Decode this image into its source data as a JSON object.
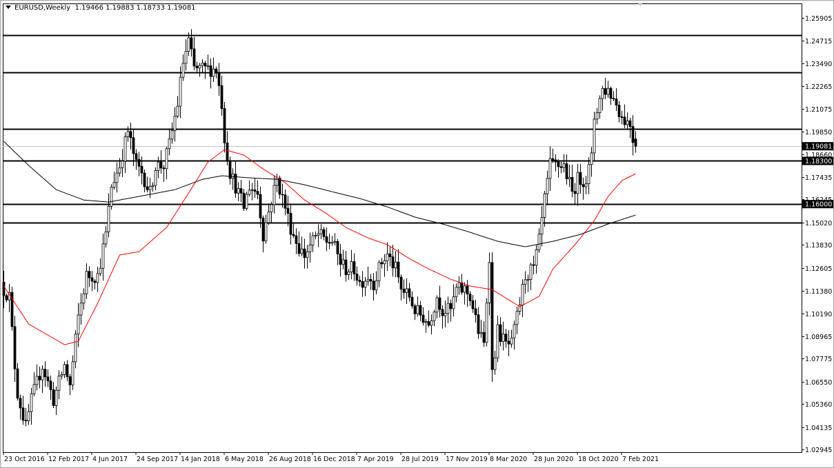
{
  "header": {
    "symbol": "EURUSD,Weekly",
    "ohlc": "1.19466 1.19883 1.18733 1.19081"
  },
  "colors": {
    "bull_body": "#ffffff",
    "bear_body": "#000000",
    "candle_line": "#000000",
    "ma_fast": "#ff0000",
    "ma_slow": "#000000",
    "level_line": "#000000",
    "price_line": "#c0c0c0"
  },
  "chart_data": {
    "type": "candlestick",
    "title": "EURUSD,Weekly",
    "ylim": [
      1.028,
      1.2668
    ],
    "weeks": 230,
    "last_candle": {
      "open": 1.19466,
      "high": 1.19883,
      "low": 1.18733,
      "close": 1.19081
    },
    "close_keypoints": [
      [
        0,
        1.1145
      ],
      [
        2,
        1.1109
      ],
      [
        4,
        1.0742
      ],
      [
        5,
        1.0595
      ],
      [
        8,
        1.0412
      ],
      [
        10,
        1.0558
      ],
      [
        14,
        1.0742
      ],
      [
        18,
        1.0558
      ],
      [
        22,
        1.0742
      ],
      [
        24,
        1.0632
      ],
      [
        27,
        1.0999
      ],
      [
        30,
        1.1219
      ],
      [
        34,
        1.1219
      ],
      [
        37,
        1.1439
      ],
      [
        39,
        1.1696
      ],
      [
        42,
        1.1806
      ],
      [
        45,
        1.1989
      ],
      [
        48,
        1.1806
      ],
      [
        50,
        1.1769
      ],
      [
        53,
        1.1659
      ],
      [
        55,
        1.1806
      ],
      [
        58,
        1.1806
      ],
      [
        60,
        1.1916
      ],
      [
        63,
        1.2136
      ],
      [
        65,
        1.2356
      ],
      [
        67,
        1.2466
      ],
      [
        69,
        1.2319
      ],
      [
        73,
        1.2319
      ],
      [
        77,
        1.2319
      ],
      [
        79,
        1.2136
      ],
      [
        80,
        1.1952
      ],
      [
        82,
        1.1769
      ],
      [
        84,
        1.1696
      ],
      [
        87,
        1.1585
      ],
      [
        89,
        1.1696
      ],
      [
        92,
        1.1659
      ],
      [
        94,
        1.1439
      ],
      [
        97,
        1.1622
      ],
      [
        99,
        1.1732
      ],
      [
        102,
        1.1585
      ],
      [
        104,
        1.1476
      ],
      [
        107,
        1.1366
      ],
      [
        109,
        1.1329
      ],
      [
        112,
        1.1402
      ],
      [
        114,
        1.1439
      ],
      [
        117,
        1.1402
      ],
      [
        119,
        1.1402
      ],
      [
        122,
        1.1292
      ],
      [
        124,
        1.1255
      ],
      [
        127,
        1.1255
      ],
      [
        129,
        1.1182
      ],
      [
        132,
        1.1219
      ],
      [
        134,
        1.1182
      ],
      [
        137,
        1.1292
      ],
      [
        139,
        1.1329
      ],
      [
        142,
        1.1255
      ],
      [
        144,
        1.1145
      ],
      [
        147,
        1.1109
      ],
      [
        149,
        1.1035
      ],
      [
        152,
        1.0999
      ],
      [
        154,
        1.0962
      ],
      [
        157,
        1.1109
      ],
      [
        159,
        1.1035
      ],
      [
        162,
        1.1035
      ],
      [
        164,
        1.1145
      ],
      [
        167,
        1.1145
      ],
      [
        169,
        1.1109
      ],
      [
        172,
        1.0925
      ],
      [
        174,
        1.0852
      ],
      [
        176,
        1.1329
      ],
      [
        177,
        1.0705
      ],
      [
        179,
        1.0925
      ],
      [
        182,
        1.0852
      ],
      [
        184,
        1.0852
      ],
      [
        187,
        1.1072
      ],
      [
        189,
        1.1219
      ],
      [
        192,
        1.1255
      ],
      [
        194,
        1.1402
      ],
      [
        196,
        1.1622
      ],
      [
        198,
        1.1806
      ],
      [
        201,
        1.1806
      ],
      [
        203,
        1.1806
      ],
      [
        206,
        1.1659
      ],
      [
        208,
        1.1732
      ],
      [
        211,
        1.1732
      ],
      [
        213,
        1.1842
      ],
      [
        214,
        1.2062
      ],
      [
        217,
        1.2209
      ],
      [
        219,
        1.2209
      ],
      [
        222,
        1.2136
      ],
      [
        224,
        1.2062
      ],
      [
        227,
        1.2026
      ],
      [
        228,
        1.1952
      ],
      [
        229,
        1.1908
      ]
    ],
    "series": [
      {
        "name": "MA fast (red)",
        "keypoints": [
          [
            0,
            1.1164
          ],
          [
            9,
            1.0962
          ],
          [
            22,
            1.0852
          ],
          [
            27,
            1.087
          ],
          [
            34,
            1.1072
          ],
          [
            42,
            1.1329
          ],
          [
            49,
            1.1347
          ],
          [
            59,
            1.1476
          ],
          [
            67,
            1.1659
          ],
          [
            74,
            1.1824
          ],
          [
            80,
            1.189
          ],
          [
            87,
            1.1861
          ],
          [
            94,
            1.1787
          ],
          [
            102,
            1.1714
          ],
          [
            109,
            1.1622
          ],
          [
            117,
            1.1549
          ],
          [
            124,
            1.1476
          ],
          [
            132,
            1.142
          ],
          [
            139,
            1.1384
          ],
          [
            147,
            1.131
          ],
          [
            154,
            1.1255
          ],
          [
            162,
            1.12
          ],
          [
            169,
            1.1164
          ],
          [
            177,
            1.1145
          ],
          [
            187,
            1.1054
          ],
          [
            194,
            1.1109
          ],
          [
            199,
            1.1255
          ],
          [
            207,
            1.1384
          ],
          [
            214,
            1.1512
          ],
          [
            219,
            1.1641
          ],
          [
            224,
            1.1725
          ],
          [
            229,
            1.1762
          ]
        ]
      },
      {
        "name": "MA slow (black)",
        "keypoints": [
          [
            0,
            1.1934
          ],
          [
            9,
            1.1806
          ],
          [
            19,
            1.1677
          ],
          [
            29,
            1.1622
          ],
          [
            38,
            1.1611
          ],
          [
            49,
            1.1641
          ],
          [
            62,
            1.1677
          ],
          [
            72,
            1.1732
          ],
          [
            79,
            1.1751
          ],
          [
            89,
            1.174
          ],
          [
            99,
            1.1732
          ],
          [
            109,
            1.1703
          ],
          [
            119,
            1.1666
          ],
          [
            129,
            1.163
          ],
          [
            139,
            1.1585
          ],
          [
            149,
            1.1531
          ],
          [
            159,
            1.1494
          ],
          [
            169,
            1.145
          ],
          [
            179,
            1.1402
          ],
          [
            189,
            1.1373
          ],
          [
            199,
            1.1402
          ],
          [
            209,
            1.1439
          ],
          [
            219,
            1.1494
          ],
          [
            229,
            1.1542
          ]
        ]
      }
    ],
    "levels": [
      1.25,
      1.23,
      1.2,
      1.183,
      1.16,
      1.15
    ],
    "level_labels": [
      {
        "price": 1.183,
        "text": "1.18300"
      },
      {
        "price": 1.16,
        "text": "1.16000"
      }
    ],
    "current_price": {
      "price": 1.19081,
      "text": "1.19081"
    },
    "y_ticks": [
      {
        "price": 1.25905,
        "text": "1.25905"
      },
      {
        "price": 1.24715,
        "text": "1.24715"
      },
      {
        "price": 1.2349,
        "text": "1.23490"
      },
      {
        "price": 1.22265,
        "text": "1.22265"
      },
      {
        "price": 1.21075,
        "text": "1.21075"
      },
      {
        "price": 1.1985,
        "text": "1.19850"
      },
      {
        "price": 1.1866,
        "text": "1.18660"
      },
      {
        "price": 1.17435,
        "text": "1.17435"
      },
      {
        "price": 1.16245,
        "text": "1.16245"
      },
      {
        "price": 1.1502,
        "text": "1.15020"
      },
      {
        "price": 1.1383,
        "text": "1.13830"
      },
      {
        "price": 1.12605,
        "text": "1.12605"
      },
      {
        "price": 1.1138,
        "text": "1.11380"
      },
      {
        "price": 1.1019,
        "text": "1.10190"
      },
      {
        "price": 1.08965,
        "text": "1.08965"
      },
      {
        "price": 1.07775,
        "text": "1.07775"
      },
      {
        "price": 1.0655,
        "text": "1.06550"
      },
      {
        "price": 1.0536,
        "text": "1.05360"
      },
      {
        "price": 1.04135,
        "text": "1.04135"
      },
      {
        "price": 1.02945,
        "text": "1.02945"
      }
    ],
    "x_ticks": [
      {
        "week": 0,
        "text": "23 Oct 2016"
      },
      {
        "week": 16,
        "text": "12 Feb 2017"
      },
      {
        "week": 32,
        "text": "4 Jun 2017"
      },
      {
        "week": 48,
        "text": "24 Sep 2017"
      },
      {
        "week": 64,
        "text": "14 Jan 2018"
      },
      {
        "week": 80,
        "text": "6 May 2018"
      },
      {
        "week": 96,
        "text": "26 Aug 2018"
      },
      {
        "week": 112,
        "text": "16 Dec 2018"
      },
      {
        "week": 128,
        "text": "7 Apr 2019"
      },
      {
        "week": 144,
        "text": "28 Jul 2019"
      },
      {
        "week": 160,
        "text": "17 Nov 2019"
      },
      {
        "week": 176,
        "text": "8 Mar 2020"
      },
      {
        "week": 192,
        "text": "28 Jun 2020"
      },
      {
        "week": 208,
        "text": "18 Oct 2020"
      },
      {
        "week": 224,
        "text": "7 Feb 2021"
      }
    ]
  }
}
